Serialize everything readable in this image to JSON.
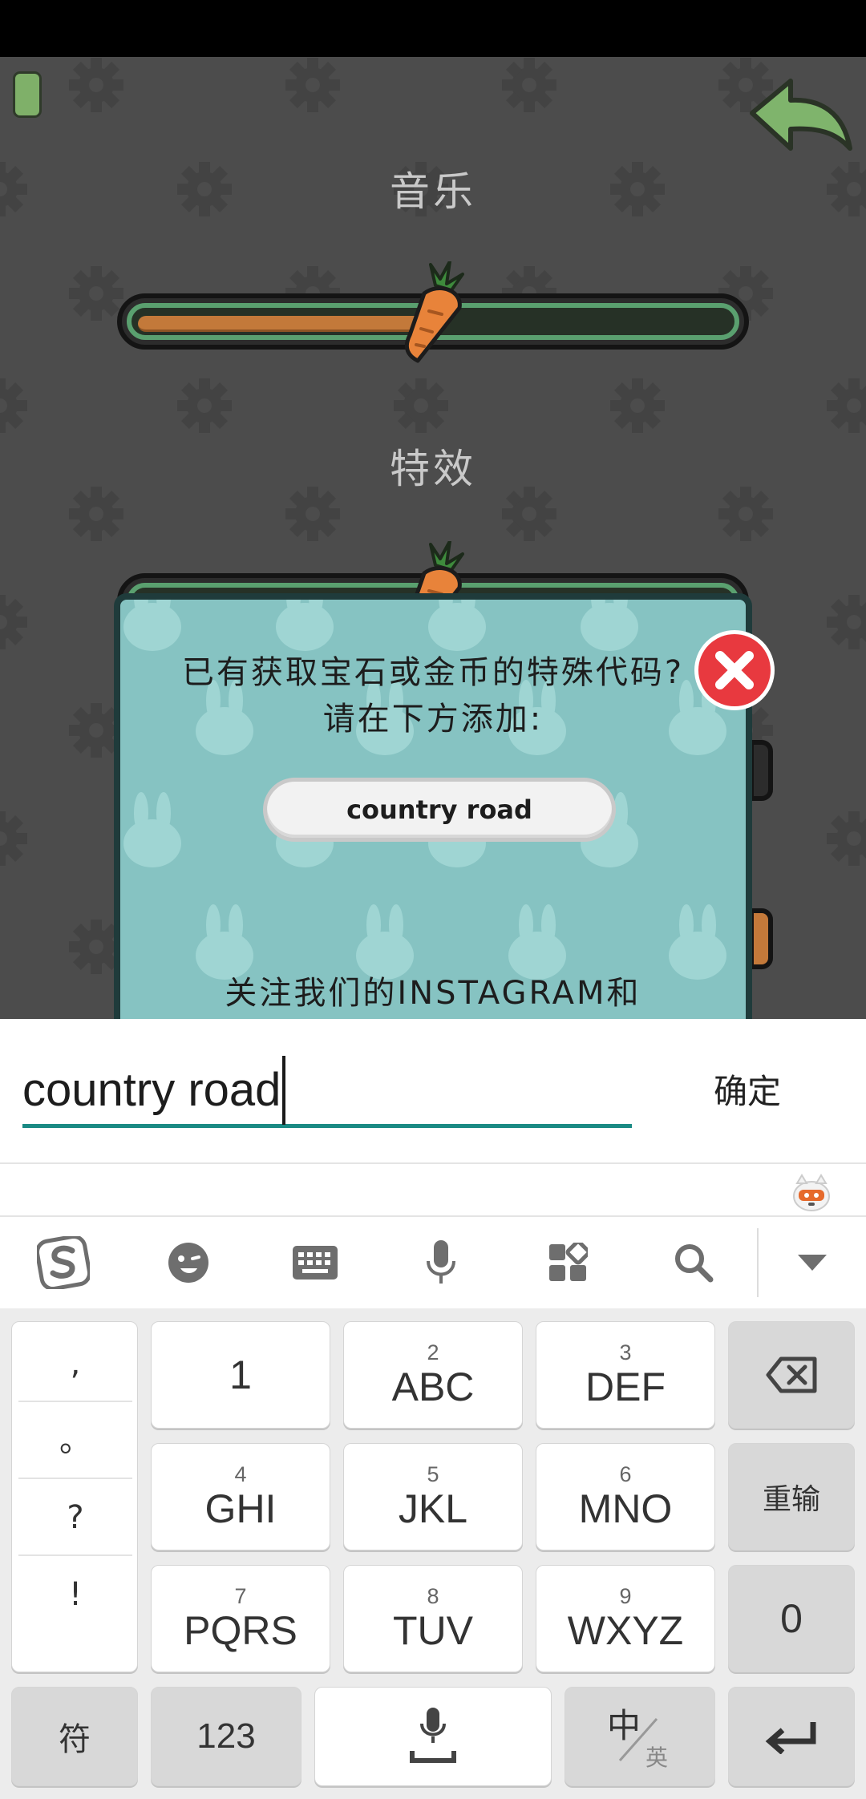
{
  "settings": {
    "music_label": "音乐",
    "music_level": 0.5,
    "effects_label": "特效",
    "effects_level": 0.5
  },
  "dialog": {
    "line1": "已有获取宝石或金币的特殊代码?",
    "line2": "请在下方添加:",
    "code_value": "country road",
    "line3": "关注我们的INSTAGRAM和"
  },
  "input_bar": {
    "value": "country road",
    "confirm_label": "确定"
  },
  "toolbar": {
    "icons": [
      "sogou-logo-icon",
      "emoji-icon",
      "keyboard-icon",
      "microphone-icon",
      "grid-icon",
      "search-icon",
      "collapse-icon"
    ]
  },
  "keyboard": {
    "punctuation": [
      ",",
      "。",
      "?",
      "!"
    ],
    "keys": {
      "k1": {
        "main": "1"
      },
      "k2": {
        "num": "2",
        "main": "ABC"
      },
      "k3": {
        "num": "3",
        "main": "DEF"
      },
      "k4": {
        "num": "4",
        "main": "GHI"
      },
      "k5": {
        "num": "5",
        "main": "JKL"
      },
      "k6": {
        "num": "6",
        "main": "MNO"
      },
      "k7": {
        "num": "7",
        "main": "PQRS"
      },
      "k8": {
        "num": "8",
        "main": "TUV"
      },
      "k9": {
        "num": "9",
        "main": "WXYZ"
      },
      "k0": {
        "main": "0"
      }
    },
    "reenter_label": "重输",
    "symbol_label": "符",
    "numeric_label": "123",
    "lang_main": "中",
    "lang_sub": "英"
  }
}
